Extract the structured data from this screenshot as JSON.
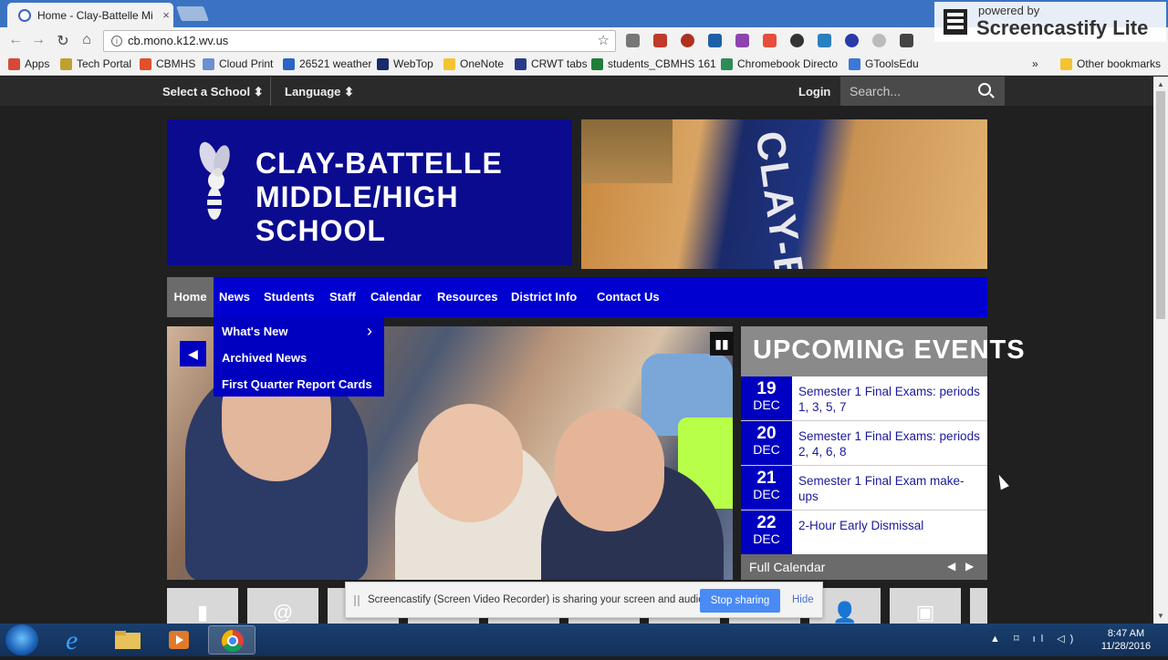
{
  "browser": {
    "tab_title": "Home - Clay-Battelle Mi",
    "tab_close": "×",
    "url": "cb.mono.k12.wv.us",
    "info_icon": "i",
    "star": "☆",
    "nav_icons": {
      "back": "←",
      "forward": "→",
      "reload": "↻",
      "home": "⌂"
    },
    "overflow": "»",
    "bookmarks": [
      {
        "label": "Apps",
        "color": "#d64937"
      },
      {
        "label": "Tech Portal",
        "color": "#c0a030"
      },
      {
        "label": "CBMHS",
        "color": "#e0502a"
      },
      {
        "label": "Cloud Print",
        "color": "#6b8fd0"
      },
      {
        "label": "26521 weather",
        "color": "#2a64c4"
      },
      {
        "label": "WebTop",
        "color": "#1a2a6a"
      },
      {
        "label": "OneNote",
        "color": "#f4c430"
      },
      {
        "label": "CRWT tabs",
        "color": "#2a3a8a"
      },
      {
        "label": "students_CBMHS 161",
        "color": "#1e7d3a"
      },
      {
        "label": "Chromebook Directo",
        "color": "#2e8b57"
      },
      {
        "label": "GToolsEdu",
        "color": "#3c78d8"
      }
    ],
    "other_bookmarks": "Other bookmarks"
  },
  "screencastify": {
    "powered_by": "powered by",
    "name": "Screencastify Lite",
    "share_message": "Screencastify (Screen Video Recorder) is sharing your screen and audio.",
    "stop_label": "Stop sharing",
    "hide_label": "Hide"
  },
  "topbar": {
    "select_school": "Select a School ⬍",
    "language": "Language ⬍",
    "login": "Login",
    "search_placeholder": "Search..."
  },
  "header": {
    "school_name": "CLAY-BATTELLE MIDDLE/HIGH SCHOOL",
    "gym_floor_text": "CLAY-BATT"
  },
  "nav": {
    "items": [
      "Home",
      "News",
      "Students",
      "Staff",
      "Calendar",
      "Resources",
      "District Info",
      "Contact Us"
    ]
  },
  "news_dropdown": {
    "items": [
      "What's New",
      "Archived News",
      "First Quarter Report Cards"
    ],
    "chevron": "›"
  },
  "slideshow": {
    "prev": "◀",
    "pause": "▮▮"
  },
  "events": {
    "title": "UPCOMING EVENTS",
    "items": [
      {
        "day": "19",
        "month": "DEC",
        "title": "Semester 1 Final Exams: periods 1, 3, 5, 7"
      },
      {
        "day": "20",
        "month": "DEC",
        "title": "Semester 1 Final Exams: periods 2, 4, 6, 8"
      },
      {
        "day": "21",
        "month": "DEC",
        "title": "Semester 1 Final Exam make-ups"
      },
      {
        "day": "22",
        "month": "DEC",
        "title": "2-Hour Early Dismissal"
      }
    ],
    "full_calendar": "Full Calendar",
    "prev": "◀",
    "next": "▶"
  },
  "quicklinks": [
    "▮",
    "@",
    "",
    "",
    "",
    "",
    "",
    "",
    "",
    "👤",
    "▣"
  ],
  "taskbar": {
    "time": "8:47 AM",
    "date": "11/28/2016",
    "tray": "▲ ⌑ ıl ◁)"
  }
}
